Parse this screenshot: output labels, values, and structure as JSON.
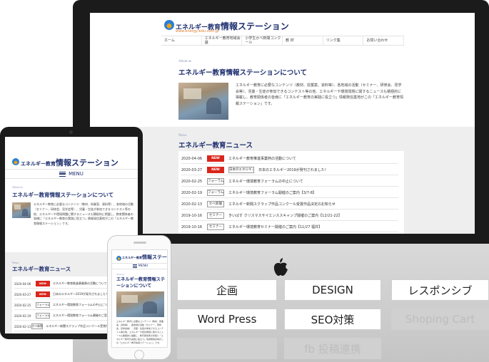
{
  "site": {
    "logo_prefix": "エネルギー教育",
    "logo_main": "情報ステーション",
    "logo_url": "www.energy-edu.com.jp"
  },
  "desktop_nav": [
    "ホーム",
    "エネルギー教育地域会議",
    "小学生かべ新聞コンクール",
    "教 材",
    "リンク集",
    "お問い合わせ"
  ],
  "about": {
    "tag": "About us",
    "title": "エネルギー教育情報ステーションについて",
    "body": "エネルギー教育に必要なコンテンツ（教材、授業案、資料等）、各地域の活動（セミナー、研修会、見学会等）、児童・生徒が参加できるコンテスト等の他、エネルギーや環境問題に関するニュースも積極的に掲載し、教育関係者の皆様に「エネルギー教育の実践に役立つ」情報発信基地がこの「エネルギー教育情報ステーション」です。"
  },
  "news": {
    "tag": "News",
    "title": "エネルギー教育ニュース",
    "items": [
      {
        "date": "2020-04-06",
        "tag": "NEW",
        "new": true,
        "title": "エネルギー教育推進事業熱の活動について"
      },
      {
        "date": "2020-03-27",
        "tag": "NEW",
        "new": true,
        "tag2": "日本のエネルギー",
        "title": "日本のエネルギー2019が発刊されました！"
      },
      {
        "date": "2020-02-25",
        "tag": "フォーラム",
        "new": false,
        "title": "エネルギー環境教育フォーラムの中止について"
      },
      {
        "date": "2020-02-19",
        "tag": "フォーラム",
        "new": false,
        "title": "エネルギー環境教育フォーラム開催のご案内【3/7-8】"
      },
      {
        "date": "2020-02-13",
        "tag": "かべ新聞",
        "new": false,
        "title": "エネルギー新聞スクラップ作品コンクール受賞作品決定のお知らせ"
      },
      {
        "date": "2019-10-16",
        "tag": "セミナー",
        "new": false,
        "title": "きいばす クリスマスサイエンススキャンプ開催のご案内【12/21-22】"
      },
      {
        "date": "2019-10-16",
        "tag": "セミナー",
        "new": false,
        "title": "エネルギー環境教育セミナー開催のご案内【11/27 福井】"
      }
    ]
  },
  "menu_label": "MENU",
  "features": {
    "kikaku": "企画",
    "design": "DESIGN",
    "responsive": "レスポンシブ",
    "wordpress": "Word Press",
    "seo": "SEO対策",
    "shopping": "Shoping Cart",
    "fb": "fb 投稿連携"
  }
}
